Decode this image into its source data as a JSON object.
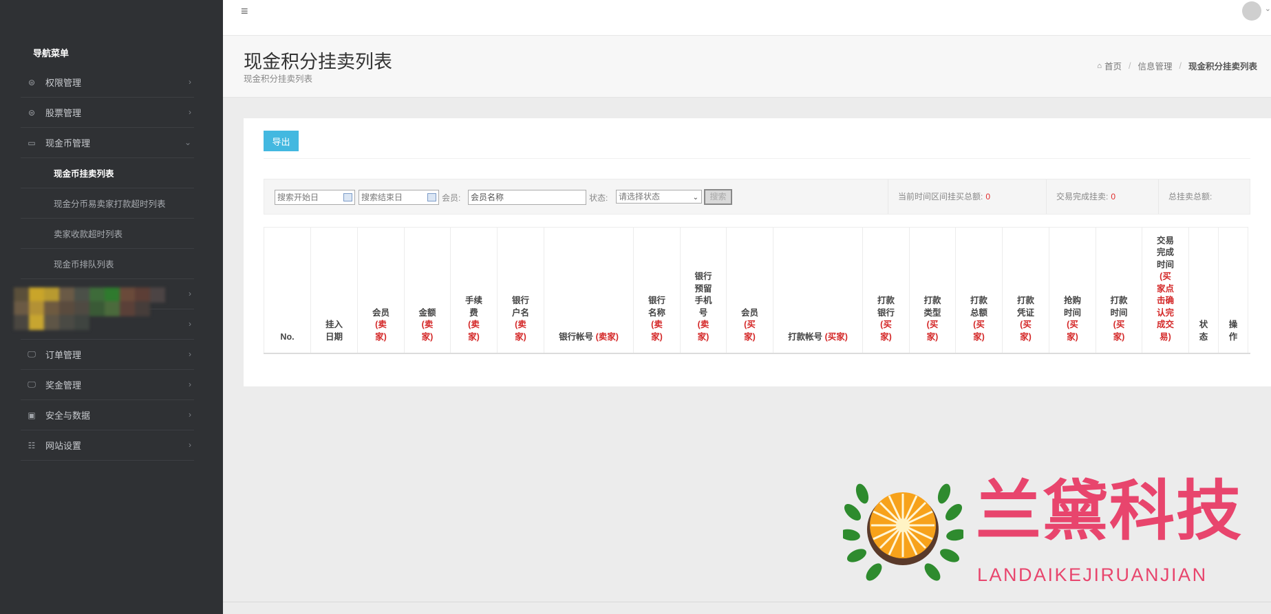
{
  "sidebar": {
    "header": "导航菜单",
    "items": [
      {
        "label": "权限管理",
        "icon": "privilege-icon",
        "glyph": "⊜",
        "arrow": "›"
      },
      {
        "label": "股票管理",
        "icon": "stock-icon",
        "glyph": "⊜",
        "arrow": "›"
      },
      {
        "label": "现金币管理",
        "icon": "cash-coin-icon",
        "glyph": "▭",
        "arrow": "⌄"
      }
    ],
    "subitems": [
      {
        "label": "现金币挂卖列表",
        "active": true
      },
      {
        "label": "现金分币易卖家打款超时列表",
        "active": false
      },
      {
        "label": "卖家收款超时列表",
        "active": false
      },
      {
        "label": "现金币排队列表",
        "active": false
      }
    ],
    "blurred_items_arrow": "›",
    "lower_items": [
      {
        "label": "订单管理",
        "icon": "monitor-icon",
        "glyph": "🖵",
        "arrow": "›"
      },
      {
        "label": "奖金管理",
        "icon": "monitor-icon",
        "glyph": "🖵",
        "arrow": "›"
      },
      {
        "label": "安全与数据",
        "icon": "wallet-icon",
        "glyph": "▣",
        "arrow": "›"
      },
      {
        "label": "网站设置",
        "icon": "sliders-icon",
        "glyph": "☷",
        "arrow": "›"
      }
    ]
  },
  "topbar": {
    "menu_glyph": "≡",
    "caret": "⌄"
  },
  "page": {
    "title": "现金积分挂卖列表",
    "subtitle": "现金积分挂卖列表",
    "breadcrumb": [
      "首页",
      "信息管理",
      "现金积分挂卖列表"
    ],
    "breadcrumb_sep": "/",
    "home_glyph": "⌂"
  },
  "toolbar": {
    "export_label": "导出"
  },
  "filters": {
    "start_date_placeholder": "搜索开始日",
    "end_date_placeholder": "搜索结束日",
    "member_label": "会员:",
    "member_placeholder": "会员名称",
    "status_label": "状态:",
    "status_selected": "请选择状态",
    "search_label": "搜索",
    "caret": "⌄"
  },
  "stats": {
    "period_total_label": "当前时间区间挂买总额:",
    "period_total_value": "0",
    "completed_label": "交易完成挂卖:",
    "completed_value": "0",
    "total_label": "总挂卖总额:"
  },
  "table": {
    "columns": [
      {
        "text": "No.",
        "note": ""
      },
      {
        "text": "挂入日期",
        "note": ""
      },
      {
        "text": "会员",
        "note": "(卖家)"
      },
      {
        "text": "金额",
        "note": "(卖家)"
      },
      {
        "text": "手续费",
        "note": "(卖家)"
      },
      {
        "text": "银行户名",
        "note": "(卖家)"
      },
      {
        "text": "银行帐号",
        "note": "(卖家)"
      },
      {
        "text": "银行名称",
        "note": "(卖家)"
      },
      {
        "text": "银行预留手机号",
        "note": "(卖家)"
      },
      {
        "text": "会员",
        "note": "(买家)"
      },
      {
        "text": "打款帐号",
        "note": "(买家)"
      },
      {
        "text": "打款银行",
        "note": "(买家)"
      },
      {
        "text": "打款类型",
        "note": "(买家)"
      },
      {
        "text": "打款总额",
        "note": "(买家)"
      },
      {
        "text": "打款凭证",
        "note": "(买家)"
      },
      {
        "text": "抢购时间",
        "note": "(买家)"
      },
      {
        "text": "打款时间",
        "note": "(买家)"
      },
      {
        "text": "交易完成时间",
        "note": "(买家点击确认完成交易)"
      },
      {
        "text": "状态",
        "note": ""
      },
      {
        "text": "操作",
        "note": ""
      }
    ]
  },
  "watermark": {
    "brand": "兰黛科技",
    "brand_sub": "LANDAIKEJIRUANJIAN"
  },
  "colors": {
    "sidebar_bg": "#2f3134",
    "accent": "#43b8e0",
    "red_note": "#d42828",
    "watermark": "#e8456d"
  }
}
